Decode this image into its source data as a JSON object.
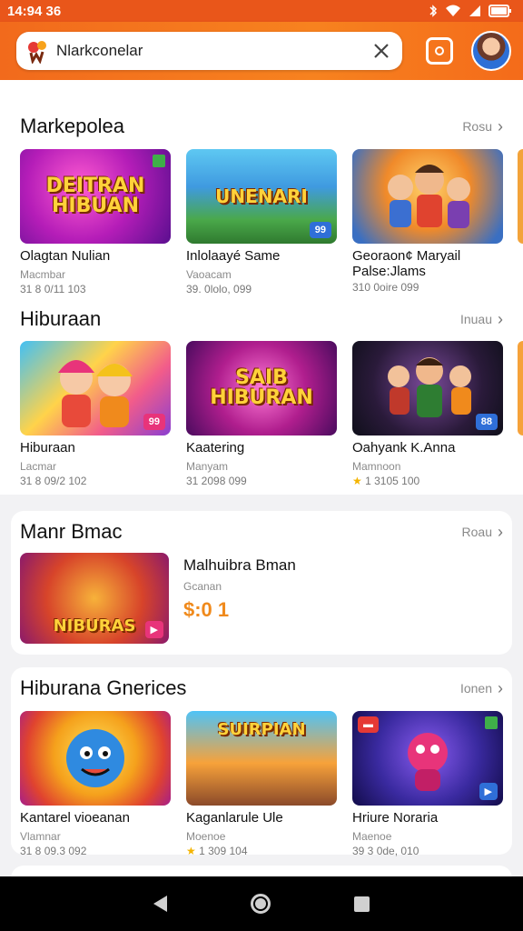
{
  "status": {
    "time": "14:94 36"
  },
  "header": {
    "search_value": "Nlarkconelar",
    "icons": [
      "app-logo-icon",
      "close-icon",
      "camera-icon",
      "avatar"
    ]
  },
  "sections": [
    {
      "title": "Markepolea",
      "see_all": "Rosu",
      "items": [
        {
          "thumb_text": "DEITRAN HIBUAN",
          "name": "Olagtan Nulian",
          "sub": "Macmbar",
          "meta": "31 8 0/11 103"
        },
        {
          "thumb_text": "UNENARI",
          "badge": "99",
          "name": "Inlolaayé Same",
          "sub": "Vaoacam",
          "meta": "39. 0lolo, 099"
        },
        {
          "name": "Georaon¢ Maryail Palse:Jlams",
          "meta": "310 0oire 099"
        }
      ]
    },
    {
      "title": "Hiburaan",
      "see_all": "Inuau",
      "items": [
        {
          "badge": "99",
          "name": "Hiburaan",
          "sub": "Lacmar",
          "meta": "31 8 09/2 102"
        },
        {
          "thumb_text": "SAIB HIBURAN",
          "name": "Kaatering",
          "sub": "Manyam",
          "meta": "31 2098 099"
        },
        {
          "badge": "88",
          "name": "Oahyank K.Anna",
          "sub": "Mamnoon",
          "meta": "1 3105 100"
        }
      ]
    },
    {
      "title": "Manr Bmac",
      "see_all": "Roau",
      "featured": {
        "thumb_text": "NIBURAS",
        "name": "Malhuibra Bman",
        "sub": "Gcanan",
        "price": "$:0 1"
      }
    },
    {
      "title": "Hiburana Gnerices",
      "see_all": "Ionen",
      "items": [
        {
          "name": "Kantarel vioeanan",
          "sub": "Vlamnar",
          "meta": "31 8 09.3 092"
        },
        {
          "thumb_text": "SUIRPIAN",
          "name": "Kaganlarule Ule",
          "sub": "Moenoe",
          "meta": "1 309 104"
        },
        {
          "name": "Hriure Noraria",
          "sub": "Maenoe",
          "meta": "39 3 0de, 010"
        }
      ]
    }
  ],
  "colors": {
    "accent": "#f26a1c",
    "price": "#f08a1c"
  }
}
